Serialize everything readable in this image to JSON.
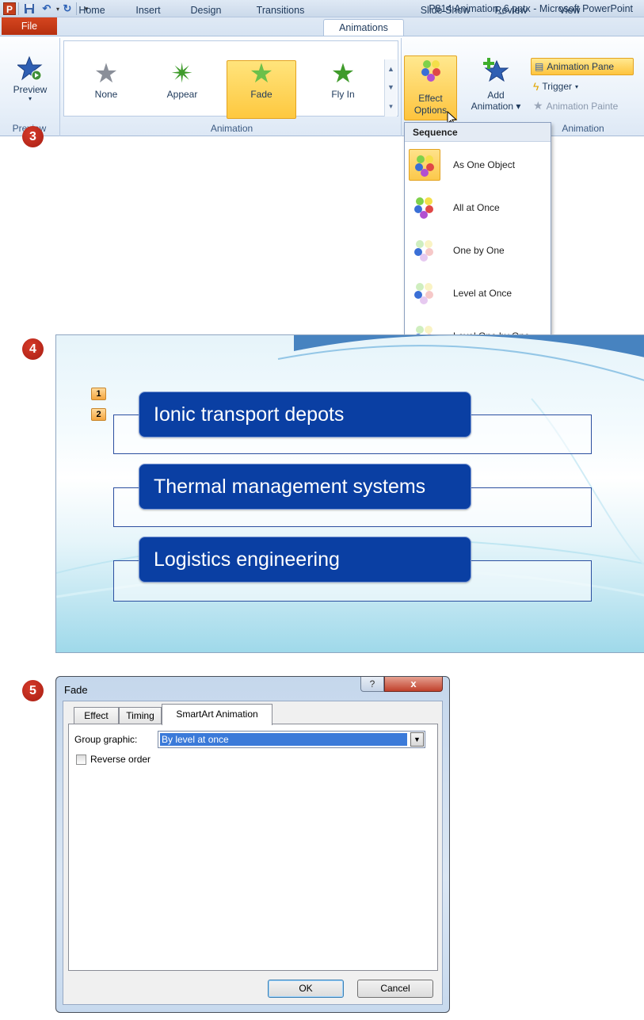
{
  "window": {
    "title": "P814 Animation_6.pptx - Microsoft PowerPoint",
    "app_icon": "P"
  },
  "quick_access": [
    "save-icon",
    "undo-icon",
    "redo-icon",
    "customize-icon"
  ],
  "tabs": [
    {
      "label": "File"
    },
    {
      "label": "Home"
    },
    {
      "label": "Insert"
    },
    {
      "label": "Design"
    },
    {
      "label": "Transitions"
    },
    {
      "label": "Animations"
    },
    {
      "label": "Slide Show"
    },
    {
      "label": "Review"
    },
    {
      "label": "View"
    }
  ],
  "ribbon": {
    "preview": {
      "label": "Preview",
      "group": "Preview"
    },
    "gallery": {
      "group": "Animation",
      "items": [
        {
          "label": "None",
          "color": "#8a8f99"
        },
        {
          "label": "Appear",
          "color": "#3f9b2b"
        },
        {
          "label": "Fade",
          "color": "#6cc04a"
        },
        {
          "label": "Fly In",
          "color": "#3f9b2b"
        }
      ],
      "selected": "Fade"
    },
    "effect_options": {
      "line1": "Effect",
      "line2": "Options"
    },
    "add_animation": {
      "line1": "Add",
      "line2": "Animation"
    },
    "animation_pane": "Animation Pane",
    "trigger": "Trigger",
    "animation_painter": "Animation Painte",
    "adv_group": "Animation"
  },
  "dropdown": {
    "header": "Sequence",
    "items": [
      {
        "label": "As One Object",
        "selected": true
      },
      {
        "label": "All at Once",
        "selected": false
      },
      {
        "label": "One by One",
        "selected": false
      },
      {
        "label": "Level at Once",
        "selected": false
      },
      {
        "label": "Level One by One",
        "selected": false
      }
    ]
  },
  "steps": [
    "3",
    "4",
    "5"
  ],
  "slide": {
    "rows": [
      "Ionic transport depots",
      "Thermal management systems",
      "Logistics engineering"
    ],
    "sequence_tags": [
      "1",
      "2"
    ]
  },
  "dialog": {
    "title": "Fade",
    "help": "?",
    "close": "x",
    "tabs": [
      "Effect",
      "Timing",
      "SmartArt Animation"
    ],
    "active_tab": "SmartArt Animation",
    "group_graphic_label": "Group graphic:",
    "group_graphic_value": "By level at once",
    "reverse_order_label": "Reverse order",
    "reverse_order_checked": false,
    "ok": "OK",
    "cancel": "Cancel"
  }
}
